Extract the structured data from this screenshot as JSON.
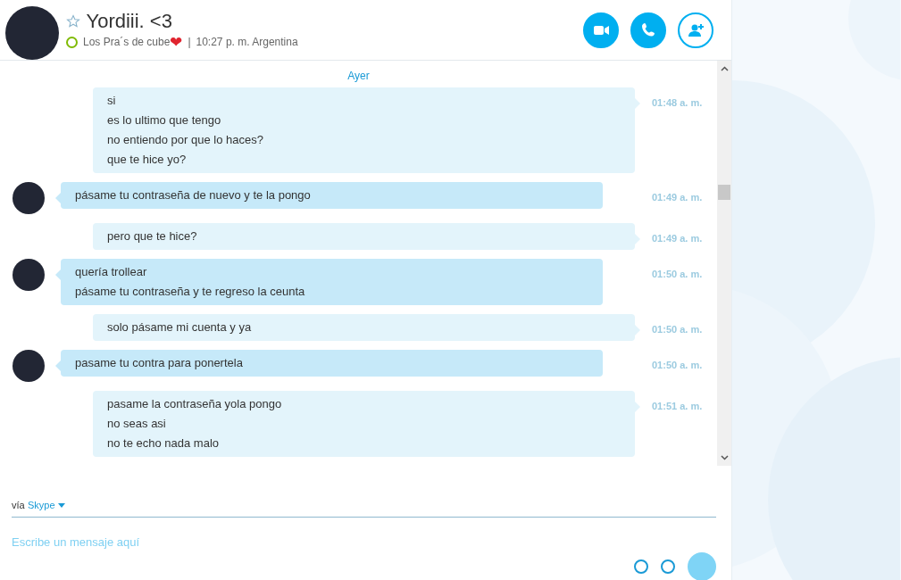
{
  "contact": {
    "name": "Yordiii. <3",
    "favorite": false,
    "online": true,
    "status_text": "Los Pra´s de cube",
    "status_emoji": "❤",
    "separator": "|",
    "local_time": "10:27 p. m. Argentina"
  },
  "header_buttons": [
    {
      "kind": "video"
    },
    {
      "kind": "call"
    },
    {
      "kind": "add-contact"
    }
  ],
  "date_divider": "Ayer",
  "messages": [
    {
      "kind": "sent",
      "lines": [
        "si",
        "es lo ultimo que tengo",
        "no entiendo por que lo haces?",
        "que te hice yo?"
      ],
      "time": "01:48 a. m."
    },
    {
      "kind": "received",
      "lines": [
        "pásame tu contraseña de nuevo y te la pongo"
      ],
      "time": "01:49 a. m."
    },
    {
      "kind": "sent",
      "lines": [
        "pero que te hice?"
      ],
      "time": "01:49 a. m."
    },
    {
      "kind": "received",
      "lines": [
        "quería trollear",
        "pásame tu contraseña y te regreso la ceunta"
      ],
      "time": "01:50 a. m."
    },
    {
      "kind": "sent",
      "lines": [
        "solo pásame mi cuenta y ya"
      ],
      "time": "01:50 a. m."
    },
    {
      "kind": "received",
      "lines": [
        "pasame tu contra para ponertela"
      ],
      "time": "01:50 a. m."
    },
    {
      "kind": "sent",
      "lines": [
        "pasame la contraseña yola pongo",
        "no seas asi",
        "no te echo nada malo"
      ],
      "time": "01:51 a. m."
    }
  ],
  "composer": {
    "via_label": "vía",
    "service": "Skype",
    "placeholder": "Escribe un mensaje aquí"
  }
}
